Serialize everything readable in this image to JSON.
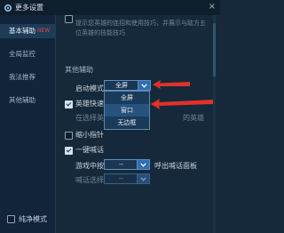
{
  "window": {
    "title": "更多设置",
    "close_glyph": "×"
  },
  "sidebar": {
    "items": [
      {
        "label": "基本辅助",
        "badge": "NEW",
        "active": true
      },
      {
        "label": "全局监控"
      },
      {
        "label": "我法推荐"
      },
      {
        "label": "其他辅助"
      }
    ],
    "pure_mode_label": "纯净模式",
    "pure_mode_checked": false
  },
  "content": {
    "faded_top_lines": [
      "提示您英雄的连招和使用技巧，并展示与敌方五",
      "位英雄的技能技巧"
    ],
    "section_title": "其他辅助",
    "launch_mode": {
      "label": "启动模式",
      "value": "全屏",
      "options": [
        "全屏",
        "窗口",
        "无边框"
      ],
      "highlighted_index": 1
    },
    "hero_quick": {
      "label": "英雄快速",
      "checked": true
    },
    "hero_quick_hint": "在选择英",
    "hero_quick_hint_tail": "的英雄",
    "mini_map": {
      "label": "缩小指针",
      "checked": false
    },
    "one_key_shout": {
      "label": "一键喊话",
      "checked": true
    },
    "game_middle": {
      "label": "游戏中按",
      "value": "--",
      "suffix": "呼出喊话面板"
    },
    "faded_bottom": {
      "label": "喊话选择",
      "value": "--",
      "suffix": ""
    }
  },
  "colors": {
    "accent": "#2e6fb2",
    "arrow": "#e2302a",
    "background": "#16293a"
  },
  "icons": {
    "settings": "gear-icon",
    "close": "close-icon",
    "dropdown": "chevron-down-icon"
  }
}
